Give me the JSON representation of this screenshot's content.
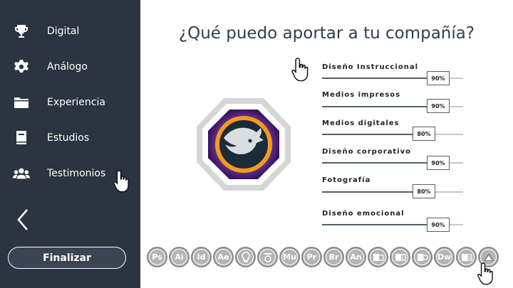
{
  "sidebar": {
    "items": [
      {
        "label": "Digital",
        "icon": "trophy-icon"
      },
      {
        "label": "Análogo",
        "icon": "gear-icon"
      },
      {
        "label": "Experiencia",
        "icon": "folder-icon"
      },
      {
        "label": "Estudios",
        "icon": "book-icon"
      },
      {
        "label": "Testimonios",
        "icon": "group-icon"
      }
    ],
    "back_icon": "chevron-left-icon",
    "finalizar_label": "Finalizar"
  },
  "main": {
    "title": "¿Qué puedo aportar a tu compañía?",
    "skills": [
      {
        "label": "Diseño Instruccional",
        "value": "90%",
        "level": 0.9
      },
      {
        "label": "Medios impresos",
        "value": "90%",
        "level": 0.9
      },
      {
        "label": "Medios digitales",
        "value": "80%",
        "level": 0.8
      },
      {
        "label": "Diseño corporativo",
        "value": "90%",
        "level": 0.9
      },
      {
        "label": "Fotografía",
        "value": "80%",
        "level": 0.8
      },
      {
        "label": "Diseño emocional",
        "value": "90%",
        "level": 0.9
      }
    ],
    "software": [
      "Ps",
      "Ai",
      "Id",
      "Ae",
      "",
      "",
      "Mu",
      "Pr",
      "Br",
      "An",
      "",
      "",
      "",
      "Dw",
      "",
      ""
    ]
  },
  "colors": {
    "sidebar_bg": "#2b3440",
    "title": "#2f3e50",
    "icon_grey": "#b4b4b4"
  }
}
